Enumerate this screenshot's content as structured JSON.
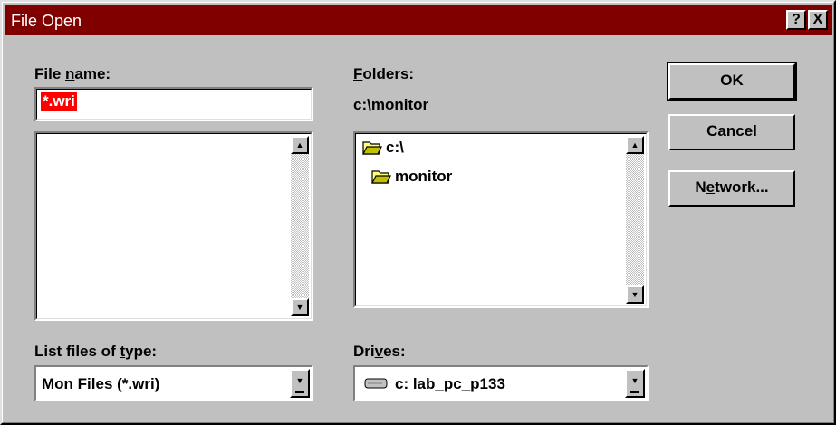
{
  "dialog": {
    "title": "File Open",
    "help_button": "?",
    "close_button": "X"
  },
  "file_name": {
    "label_pre": "File ",
    "label_accel": "n",
    "label_post": "ame:",
    "value": "*.wri"
  },
  "file_list": {
    "items": []
  },
  "folders": {
    "label_accel": "F",
    "label_post": "olders:",
    "current_path": "c:\\monitor",
    "items": [
      {
        "label": "c:\\",
        "icon": "open-folder-icon"
      },
      {
        "label": "monitor",
        "icon": "open-folder-icon"
      }
    ]
  },
  "file_type": {
    "label_pre": "List files of ",
    "label_accel": "t",
    "label_post": "ype:",
    "value": "Mon Files (*.wri)"
  },
  "drives": {
    "label_pre": "Dri",
    "label_accel": "v",
    "label_post": "es:",
    "value": "c: lab_pc_p133",
    "icon": "hard-drive-icon"
  },
  "buttons": {
    "ok": "OK",
    "cancel": "Cancel",
    "network_pre": "N",
    "network_accel": "e",
    "network_post": "twork..."
  },
  "colors": {
    "titlebar": "#800000",
    "face": "#c0c0c0",
    "selection": "#ff0000"
  }
}
